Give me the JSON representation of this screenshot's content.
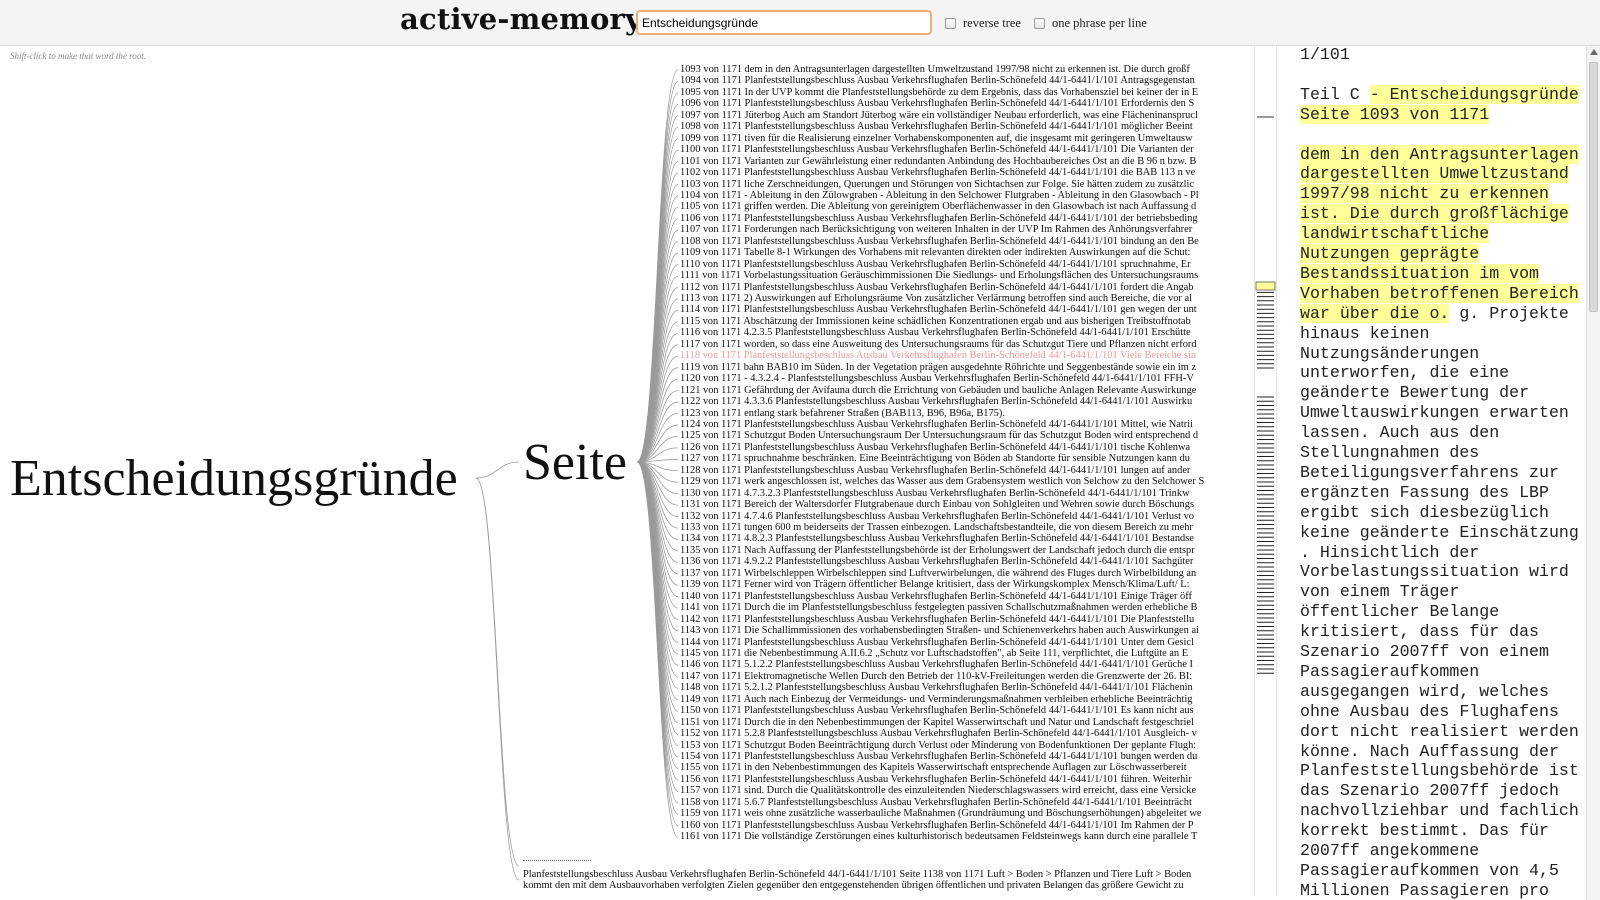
{
  "header": {
    "title": "active-memory",
    "search_value": "Entscheidungsgründe",
    "reverse_tree_label": "reverse tree",
    "one_phrase_label": "one phrase per line"
  },
  "hint": "Shift-click to make that word the root.",
  "tree": {
    "root": "Entscheidungsgründe",
    "branch": "Seite",
    "highlighted_line": "1118",
    "lines": [
      "1093 von 1171 dem in den Antragsunterlagen dargestellten Umweltzustand 1997/98 nicht zu erkennen ist. Die durch großf",
      "1094 von 1171 Planfeststellungsbeschluss Ausbau Verkehrsflughafen Berlin-Schönefeld 44/1-6441/1/101 Antragsgegenstan",
      "1095 von 1171 In der UVP kommt die Planfeststellungsbehörde zu dem Ergebnis, dass das Vorhabensziel bei keiner der in E",
      "1096 von 1171 Planfeststellungsbeschluss Ausbau Verkehrsflughafen Berlin-Schönefeld 44/1-6441/1/101 Erfordernis den S",
      "1097 von 1171 Jüterbog Auch am Standort Jüterbog wäre ein vollständiger Neubau erforderlich, was eine Flächeninansprucl",
      "1098 von 1171 Planfeststellungsbeschluss Ausbau Verkehrsflughafen Berlin-Schönefeld 44/1-6441/1/101 möglicher Beeint",
      "1099 von 1171 tiven für die Realisierung einzelner Vorhabenskomponenten auf, die insgesamt mit geringeren Umweltausw",
      "1100 von 1171 Planfeststellungsbeschluss Ausbau Verkehrsflughafen Berlin-Schönefeld 44/1-6441/1/101 Die Varianten der",
      "1101 von 1171 Varianten zur Gewährleistung einer redundanten Anbindung des Hochbaubereiches Ost an die B 96 n bzw. B",
      "1102 von 1171 Planfeststellungsbeschluss Ausbau Verkehrsflughafen Berlin-Schönefeld 44/1-6441/1/101 die BAB 113 n ve",
      "1103 von 1171 liche Zerschneidungen, Querungen und Störungen von Sichtachsen zur Folge. Sie hätten zudem zu zusätzlic",
      "1104 von 1171 - Ableitung in den Zülowgraben - Ableitung in den Selchower Flutgraben - Ableitung in den Glasowbach - Pl",
      "1105 von 1171 griffen werden. Die Ableitung von gereinigtem Oberflächenwasser in den Glasowbach ist nach Auffassung d",
      "1106 von 1171 Planfeststellungsbeschluss Ausbau Verkehrsflughafen Berlin-Schönefeld 44/1-6441/1/101 der betriebsbeding",
      "1107 von 1171 Forderungen nach Berücksichtigung von weiteren Inhalten in der UVP Im Rahmen des Anhörungsverfahrer",
      "1108 von 1171 Planfeststellungsbeschluss Ausbau Verkehrsflughafen Berlin-Schönefeld 44/1-6441/1/101 bindung an den Be",
      "1109 von 1171 Tabelle 8-1 Wirkungen des Vorhabens mit relevanten direkten oder indirekten Auswirkungen auf die Schut:",
      "1110 von 1171 Planfeststellungsbeschluss Ausbau Verkehrsflughafen Berlin-Schönefeld 44/1-6441/1/101 spruchnahme, Er",
      "1111 von 1171 Vorbelastungssituation Geräuschimmissionen Die Siedlungs- und Erholungsflächen des Untersuchungsraums",
      "1112 von 1171 Planfeststellungsbeschluss Ausbau Verkehrsflughafen Berlin-Schönefeld 44/1-6441/1/101 fordert die Angab",
      "1113 von 1171 2) Auswirkungen auf Erholungsräume Von zusätzlicher Verlärmung betroffen sind auch Bereiche, die vor al",
      "1114 von 1171 Planfeststellungsbeschluss Ausbau Verkehrsflughafen Berlin-Schönefeld 44/1-6441/1/101 gen wegen der unt",
      "1115 von 1171 Abschätzung der Immissionen keine schädlichen Konzentrationen ergab und aus bisherigen Treibstoffnotab",
      "1116 von 1171 4.2.3.5 Planfeststellungsbeschluss Ausbau Verkehrsflughafen Berlin-Schönefeld 44/1-6441/1/101 Erschütte",
      "1117 von 1171 worden, so dass eine Ausweitung des Untersuchungsraums für das Schutzgut Tiere und Pflanzen nicht erford",
      "1118 von 1171 Planfeststellungsbeschluss Ausbau Verkehrsflughafen Berlin-Schönefeld 44/1-6441/1/101 Viele Bereiche sin",
      "1119 von 1171 bahn BAB10 im Süden. In der Vegetation prägen ausgedehnte Röhrichte und Seggenbestände sowie ein im z",
      "1120 von 1171 - 4.3.2.4 - Planfeststellungsbeschluss Ausbau Verkehrsflughafen Berlin-Schönefeld 44/1-6441/1/101 FFH-V",
      "1121 von 1171 Gefährdung der Avifauna durch die Errichtung von Gebäuden und bauliche Anlagen Relevante Auswirkunge",
      "1122 von 1171 4.3.3.6 Planfeststellungsbeschluss Ausbau Verkehrsflughafen Berlin-Schönefeld 44/1-6441/1/101 Auswirku",
      "1123 von 1171 entlang stark befahrener Straßen (BAB113, B96, B96a, B175).",
      "1124 von 1171 Planfeststellungsbeschluss Ausbau Verkehrsflughafen Berlin-Schönefeld 44/1-6441/1/101 Mittel, wie Natrii",
      "1125 von 1171 Schutzgut Boden Untersuchungsraum Der Untersuchungsraum für das Schutzgut Boden wird entsprechend d",
      "1126 von 1171 Planfeststellungsbeschluss Ausbau Verkehrsflughafen Berlin-Schönefeld 44/1-6441/1/101 tische Kohlenwa",
      "1127 von 1171 spruchnahme beschränken. Eine Beeinträchtigung von Böden ab Standorte für sensible Nutzungen kann du",
      "1128 von 1171 Planfeststellungsbeschluss Ausbau Verkehrsflughafen Berlin-Schönefeld 44/1-6441/1/101 lungen auf ander",
      "1129 von 1171 werk angeschlossen ist, welches das Wasser aus dem Grabensystem westlich von Selchow zu den Selchower S",
      "1130 von 1171 4.7.3.2.3 Planfeststellungsbeschluss Ausbau Verkehrsflughafen Berlin-Schönefeld 44/1-6441/1/101 Trinkw",
      "1131 von 1171 Bereich der Waltersdorfer Flutgrabenaue durch Einbau von Sohlgleiten und Wehren sowie durch Böschungs",
      "1132 von 1171 4.7.4.6 Planfeststellungsbeschluss Ausbau Verkehrsflughafen Berlin-Schönefeld 44/1-6441/1/101 Verlust vo",
      "1133 von 1171 tungen 600 m beiderseits der Trassen einbezogen. Landschaftsbestandteile, die von diesem Bereich zu mehr",
      "1134 von 1171 4.8.2.3 Planfeststellungsbeschluss Ausbau Verkehrsflughafen Berlin-Schönefeld 44/1-6441/1/101 Bestandse",
      "1135 von 1171 Nach Auffassung der Planfeststellungsbehörde ist der Erholungswert der Landschaft jedoch durch die entspr",
      "1136 von 1171 4.9.2.2 Planfeststellungsbeschluss Ausbau Verkehrsflughafen Berlin-Schönefeld 44/1-6441/1/101 Sachgüter",
      "1137 von 1171 Wirbelschleppen Wirbelschleppen sind Luftverwirbelungen, die während des Fluges durch Wirbelbildung an",
      "1139 von 1171 Ferner wird von Trägern öffentlicher Belange kritisiert, dass der Wirkungskomplex Mensch/Klima/Luft/ L:",
      "1140 von 1171 Planfeststellungsbeschluss Ausbau Verkehrsflughafen Berlin-Schönefeld 44/1-6441/1/101 Einige Träger öff",
      "1141 von 1171 Durch die im Planfeststellungsbeschluss festgelegten passiven Schallschutzmaßnahmen werden erhebliche B",
      "1142 von 1171 Planfeststellungsbeschluss Ausbau Verkehrsflughafen Berlin-Schönefeld 44/1-6441/1/101 Die Planfeststellu",
      "1143 von 1171 Die Schallimmissionen des vorhabensbedingten Straßen- und Schienenverkehrs haben auch Auswirkungen ai",
      "1144 von 1171 Planfeststellungsbeschluss Ausbau Verkehrsflughafen Berlin-Schönefeld 44/1-6441/1/101 Unter dem Gesicl",
      "1145 von 1171 die Nebenbestimmung A.II.6.2 „Schutz vor Luftschadstoffen\", ab Seite 111, verpflichtet, die Luftgüte an E",
      "1146 von 1171 5.1.2.2 Planfeststellungsbeschluss Ausbau Verkehrsflughafen Berlin-Schönefeld 44/1-6441/1/101 Gerüche I",
      "1147 von 1171 Elektromagnetische Wellen Durch den Betrieb der 110-kV-Freileitungen werden die Grenzwerte der 26. BI:",
      "1148 von 1171 5.2.1.2 Planfeststellungsbeschluss Ausbau Verkehrsflughafen Berlin-Schönefeld 44/1-6441/1/101 Flächenin",
      "1149 von 1171 Auch nach Einbezug der Vermeidungs- und Verminderungsmaßnahmen verbleiben erhebliche Beeinträchtig",
      "1150 von 1171 Planfeststellungsbeschluss Ausbau Verkehrsflughafen Berlin-Schönefeld 44/1-6441/1/101 Es kann nicht aus",
      "1151 von 1171 Durch die in den Nebenbestimmungen der Kapitel Wasserwirtschaft und Natur und Landschaft festgeschriel",
      "1152 von 1171 5.2.8 Planfeststellungsbeschluss Ausbau Verkehrsflughafen Berlin-Schönefeld 44/1-6441/1/101 Ausgleich- v",
      "1153 von 1171 Schutzgut Boden Beeinträchtigung durch Verlust oder Minderung von Bodenfunktionen Der geplante Flugh:",
      "1154 von 1171 Planfeststellungsbeschluss Ausbau Verkehrsflughafen Berlin-Schönefeld 44/1-6441/1/101 bungen werden du",
      "1155 von 1171 in den Nebenbestimmungen des Kapitels Wasserwirtschaft entsprechende Auflagen zur Löschwasserbereit",
      "1156 von 1171 Planfeststellungsbeschluss Ausbau Verkehrsflughafen Berlin-Schönefeld 44/1-6441/1/101 führen. Weiterhir",
      "1157 von 1171 sind. Durch die Qualitätskontrolle des einzuleitenden Niederschlagswassers wird erreicht, dass eine Versicke",
      "1158 von 1171 5.6.7 Planfeststellungsbeschluss Ausbau Verkehrsflughafen Berlin-Schönefeld 44/1-6441/1/101 Beeinträcht",
      "1159 von 1171 weis ohne zusätzliche wasserbauliche Maßnahmen (Grundräumung und Böschungserhöhungen) abgeleitet we",
      "1160 von 1171 Planfeststellungsbeschluss Ausbau Verkehrsflughafen Berlin-Schönefeld 44/1-6441/1/101 Im Rahmen der P",
      "1161 von 1171 Die vollständige Zerstörungen eines kulturhistorisch bedeutsamen Feldsteinwegs kann durch eine parallele T"
    ],
    "bottom_line_1": "Planfeststellungsbeschluss Ausbau Verkehrsflughafen Berlin-Schönefeld 44/1-6441/1/101 Seite 1138 von 1171 Luft > Boden > Pflanzen und Tiere Luft > Boden",
    "bottom_line_2": "kommt den mit dem Ausbauvorhaben verfolgten Zielen gegenüber den entgegenstehenden übrigen öffentlichen und privaten Belangen das größere Gewicht zu"
  },
  "reader": {
    "lines": [
      [
        {
          "t": "1/101",
          "m": false
        }
      ],
      [],
      [
        {
          "t": "Teil C ",
          "m": false
        },
        {
          "t": "- Entscheidungsgründe",
          "m": true
        }
      ],
      [
        {
          "t": "Seite 1093 von 1171",
          "m": true
        }
      ],
      [],
      [
        {
          "t": "dem in den Antragsunterlagen",
          "m": true
        }
      ],
      [
        {
          "t": "dargestellten Umweltzustand",
          "m": true
        }
      ],
      [
        {
          "t": "1997/98 nicht zu erkennen",
          "m": true
        }
      ],
      [
        {
          "t": "ist. Die durch großflächige",
          "m": true
        }
      ],
      [
        {
          "t": "landwirtschaftliche",
          "m": true
        }
      ],
      [
        {
          "t": "Nutzungen geprägte",
          "m": true
        }
      ],
      [
        {
          "t": "Bestandssituation im vom",
          "m": true
        }
      ],
      [
        {
          "t": "Vorhaben betroffenen Bereich",
          "m": true
        }
      ],
      [
        {
          "t": "war über die o.",
          "m": true
        },
        {
          "t": " g. Projekte",
          "m": false
        }
      ],
      [
        {
          "t": "hinaus keinen",
          "m": false
        }
      ],
      [
        {
          "t": "Nutzungsänderungen",
          "m": false
        }
      ],
      [
        {
          "t": "unterworfen, die eine",
          "m": false
        }
      ],
      [
        {
          "t": "geänderte Bewertung der",
          "m": false
        }
      ],
      [
        {
          "t": "Umweltauswirkungen erwarten",
          "m": false
        }
      ],
      [
        {
          "t": "lassen. Auch aus den",
          "m": false
        }
      ],
      [
        {
          "t": "Stellungnahmen des",
          "m": false
        }
      ],
      [
        {
          "t": "Beteiligungsverfahrens zur",
          "m": false
        }
      ],
      [
        {
          "t": "ergänzten Fassung des LBP",
          "m": false
        }
      ],
      [
        {
          "t": "ergibt sich diesbezüglich",
          "m": false
        }
      ],
      [
        {
          "t": "keine geänderte Einschätzung",
          "m": false
        }
      ],
      [
        {
          "t": ". Hinsichtlich der",
          "m": false
        }
      ],
      [
        {
          "t": "Vorbelastungssituation wird",
          "m": false
        }
      ],
      [
        {
          "t": "von einem Träger",
          "m": false
        }
      ],
      [
        {
          "t": "öffentlicher Belange",
          "m": false
        }
      ],
      [
        {
          "t": "kritisiert, dass für das",
          "m": false
        }
      ],
      [
        {
          "t": "Szenario 2007ff von einem",
          "m": false
        }
      ],
      [
        {
          "t": "Passagieraufkommen",
          "m": false
        }
      ],
      [
        {
          "t": "ausgegangen wird, welches",
          "m": false
        }
      ],
      [
        {
          "t": "ohne Ausbau des Flughafens",
          "m": false
        }
      ],
      [
        {
          "t": "dort nicht realisiert werden",
          "m": false
        }
      ],
      [
        {
          "t": "könne. Nach Auffassung der",
          "m": false
        }
      ],
      [
        {
          "t": "Planfeststellungsbehörde ist",
          "m": false
        }
      ],
      [
        {
          "t": "das Szenario 2007ff jedoch",
          "m": false
        }
      ],
      [
        {
          "t": "nachvollziehbar und fachlich",
          "m": false
        }
      ],
      [
        {
          "t": "korrekt bestimmt. Das für",
          "m": false
        }
      ],
      [
        {
          "t": "2007ff angekommene",
          "m": false
        }
      ],
      [
        {
          "t": "Passagieraufkommen von 4,5",
          "m": false
        }
      ],
      [
        {
          "t": "Millionen Passagieren pro",
          "m": false
        }
      ]
    ]
  },
  "colors": {
    "highlight": "#ffff99",
    "selected_line": "#ec9b9b",
    "search_focus": "#f0b074"
  }
}
